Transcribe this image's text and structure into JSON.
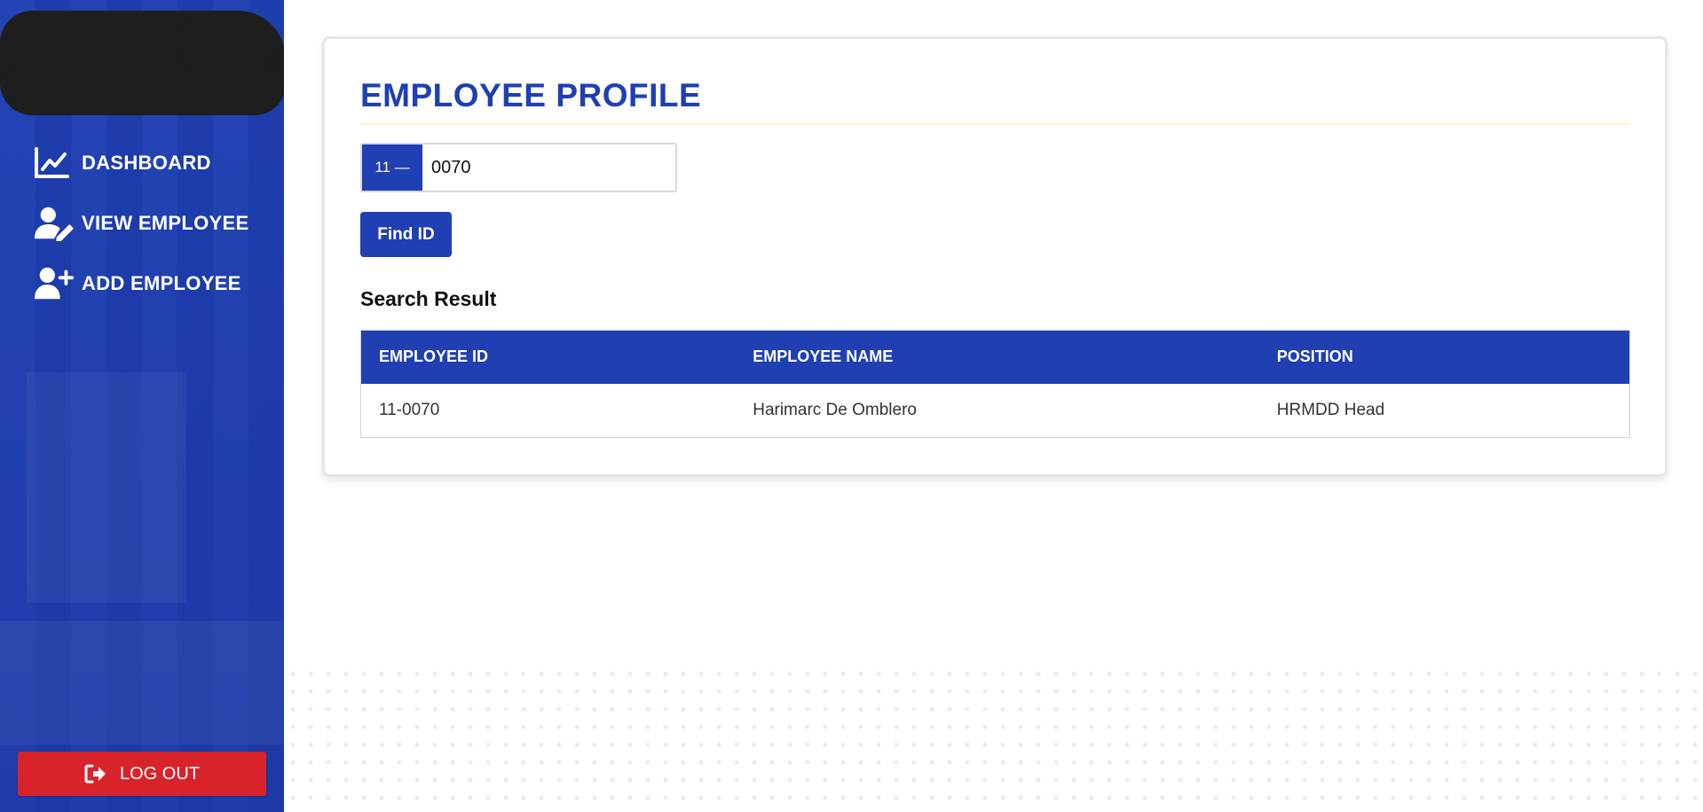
{
  "sidebar": {
    "nav": [
      {
        "label": "DASHBOARD",
        "icon": "chart-line-icon"
      },
      {
        "label": "VIEW EMPLOYEE",
        "icon": "user-edit-icon"
      },
      {
        "label": "ADD EMPLOYEE",
        "icon": "user-plus-icon"
      }
    ],
    "logout_label": "LOG OUT",
    "logout_icon": "sign-out-icon"
  },
  "main": {
    "title": "EMPLOYEE PROFILE",
    "id_prefix": "11 —",
    "id_value": "0070",
    "find_label": "Find ID",
    "result_title": "Search Result",
    "table": {
      "headers": [
        "EMPLOYEE ID",
        "EMPLOYEE NAME",
        "POSITION"
      ],
      "rows": [
        [
          "11-0070",
          "Harimarc De Omblero",
          "HRMDD Head"
        ]
      ]
    }
  },
  "colors": {
    "brand_blue": "#1f3fb3",
    "logout_red": "#d9232a",
    "title_rule": "#fbf1c4"
  }
}
